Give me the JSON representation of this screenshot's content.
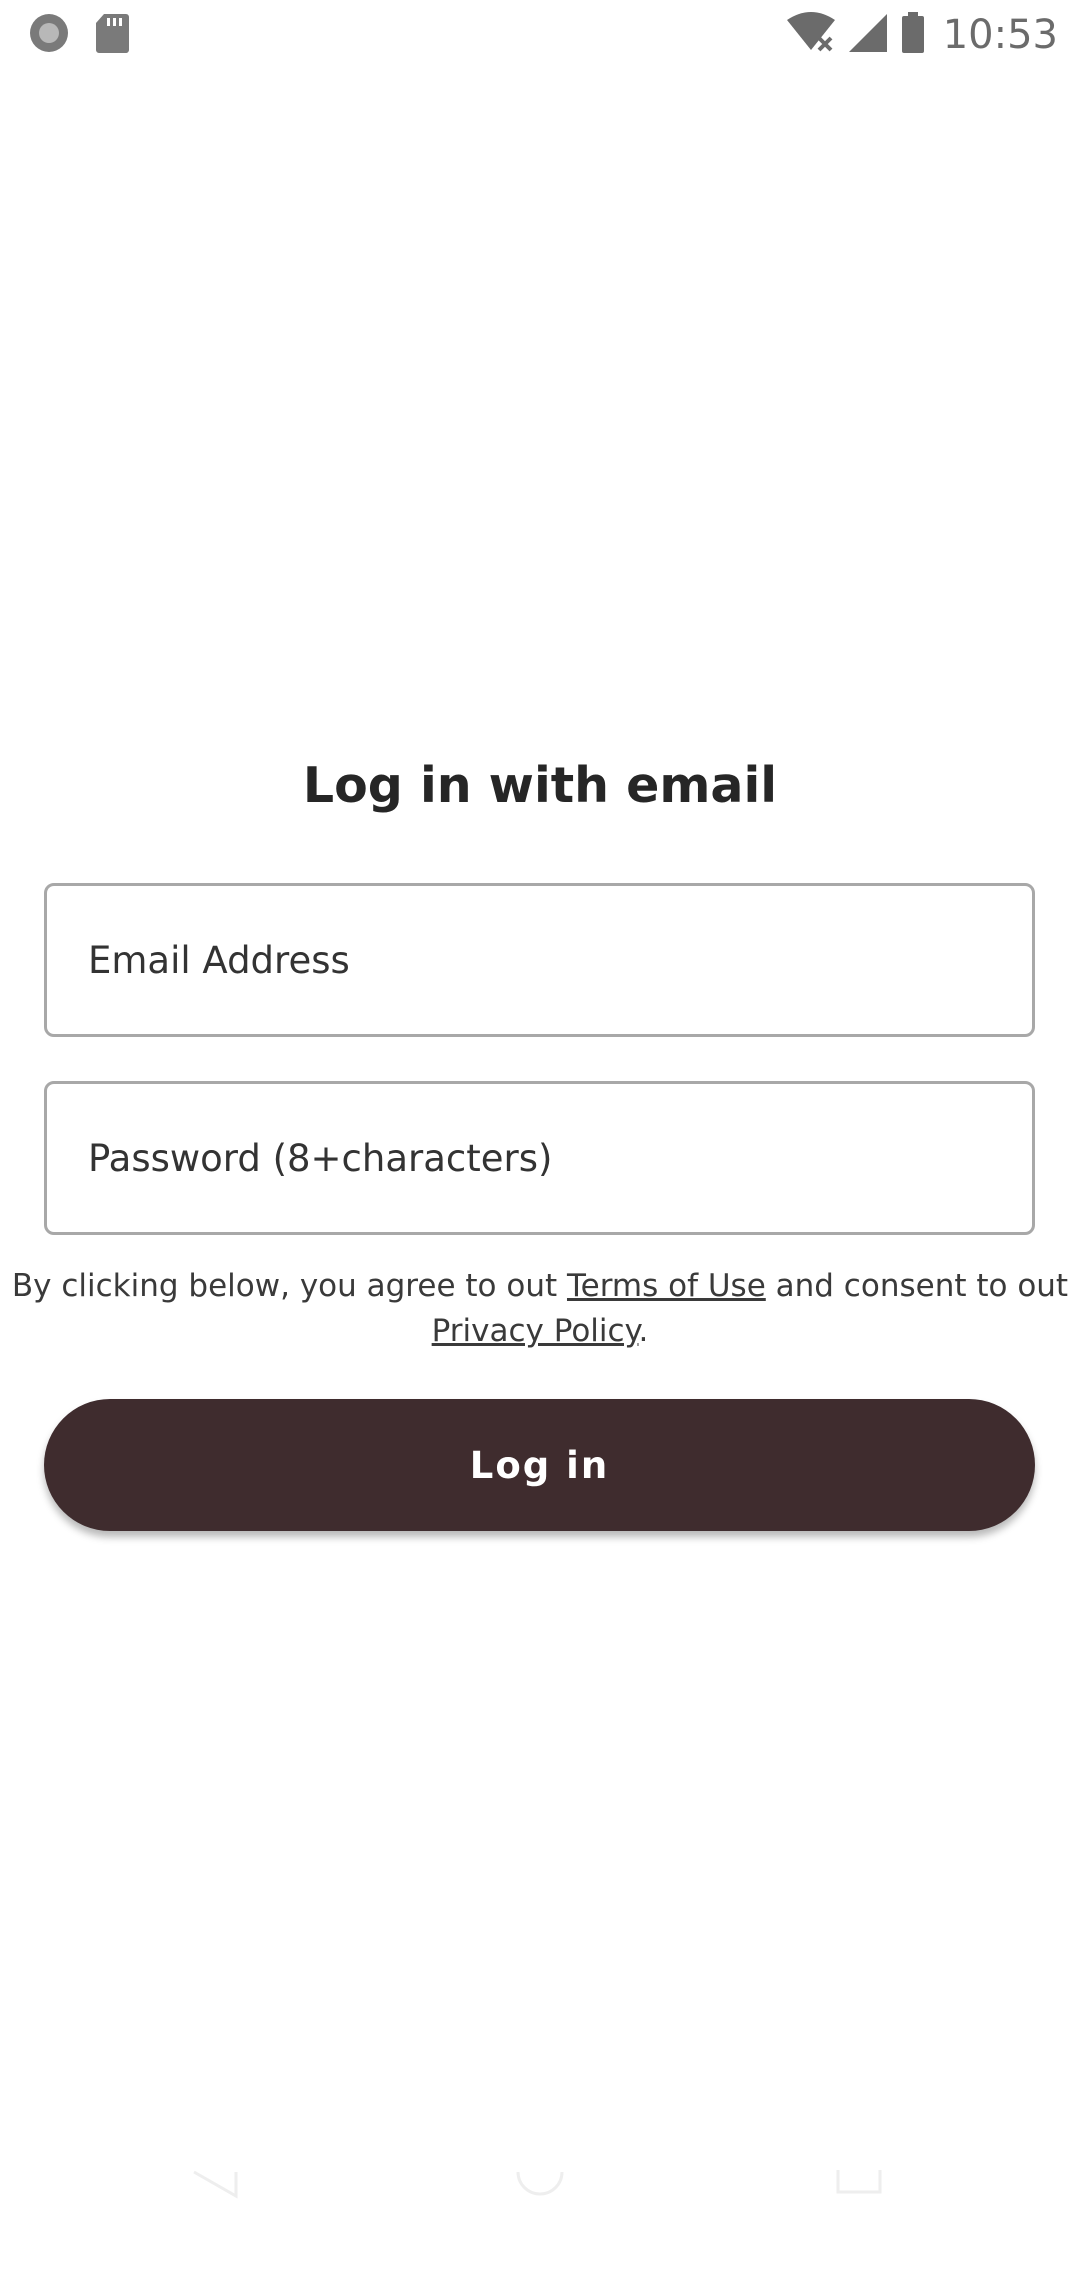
{
  "status_bar": {
    "time": "10:53",
    "left_icons": [
      "record-indicator-icon",
      "sd-card-icon"
    ],
    "right_icons": [
      "wifi-no-internet-icon",
      "cellular-signal-icon",
      "battery-icon"
    ]
  },
  "login": {
    "title": "Log in with email",
    "email_placeholder": "Email Address",
    "password_placeholder": "Password (8+characters)",
    "terms": {
      "prefix": "By clicking below, you agree to out ",
      "terms_link": "Terms of Use",
      "middle": " and consent to out ",
      "privacy_link": "Privacy Policy",
      "suffix": "."
    },
    "button_label": "Log in"
  },
  "nav_bar": {
    "buttons": [
      "back-icon",
      "home-icon",
      "recents-icon"
    ]
  },
  "colors": {
    "button_bg": "#3f2c2e",
    "button_text": "#ffffff",
    "field_border": "#a8a8a8",
    "text": "#262626"
  }
}
